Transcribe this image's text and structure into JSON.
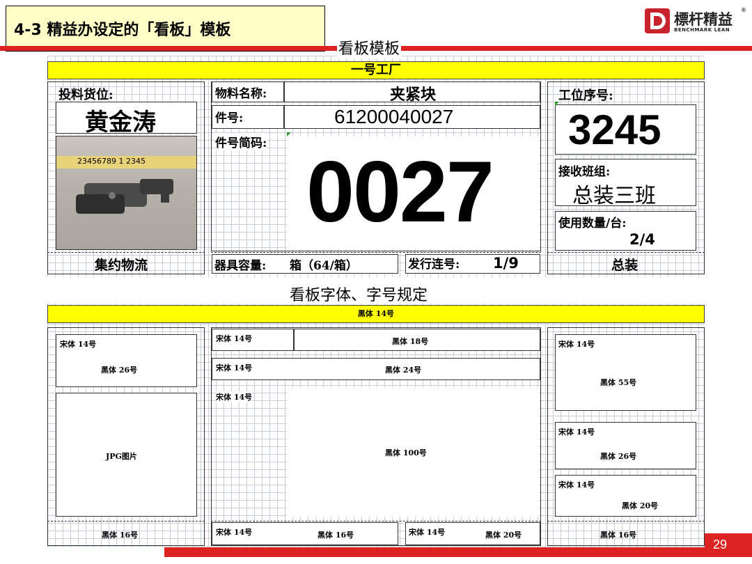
{
  "slide": {
    "title": "4-3  精益办设定的「看板」模板",
    "page_number": "29",
    "logo": {
      "cn": "標杆精益",
      "en": "BENCHMARK LEAN",
      "registered": "®"
    }
  },
  "kanban_template": {
    "heading": "看板模板",
    "factory": "一号工厂",
    "feeding_location_label": "投料货位:",
    "feeding_location_value": "黄金涛",
    "photo_ruler_text": "23456789 1 2345",
    "consolidated_logistics": "集约物流",
    "material_name_label": "物料名称:",
    "material_name_value": "夹紧块",
    "part_no_label": "件号:",
    "part_no_value": "61200040027",
    "part_short_label": "件号简码:",
    "part_short_value": "0027",
    "container_label": "器具容量:",
    "container_value": "箱（64/箱）",
    "issue_label": "发行连号:",
    "issue_value": "1/9",
    "station_label": "工位序号:",
    "station_value": "3245",
    "team_label": "接收班组:",
    "team_value": "总装三班",
    "usage_label": "使用数量/台:",
    "usage_value": "2/4",
    "assembly": "总装"
  },
  "font_spec": {
    "heading": "看板字体、字号规定",
    "bar": "黑体 14号",
    "left_small": "宋体 14号",
    "left_big": "黑体 26号",
    "left_img": "JPG图片",
    "left_bottom": "黑体 16号",
    "mid_r1_l": "宋体 14号",
    "mid_r1_r": "黑体 18号",
    "mid_r2_l": "宋体 14号",
    "mid_r2_r": "黑体 24号",
    "mid_r3_l": "宋体 14号",
    "mid_r3_big": "黑体 100号",
    "mid_b1_l": "宋体 14号",
    "mid_b1_r": "黑体 16号",
    "mid_b2_l": "宋体 14号",
    "mid_b2_r": "黑体 20号",
    "right1_l": "宋体 14号",
    "right1_big": "黑体 55号",
    "right2_l": "宋体 14号",
    "right2_r": "黑体 26号",
    "right3_l": "宋体 14号",
    "right3_r": "黑体 20号",
    "right_bottom": "黑体 16号"
  }
}
